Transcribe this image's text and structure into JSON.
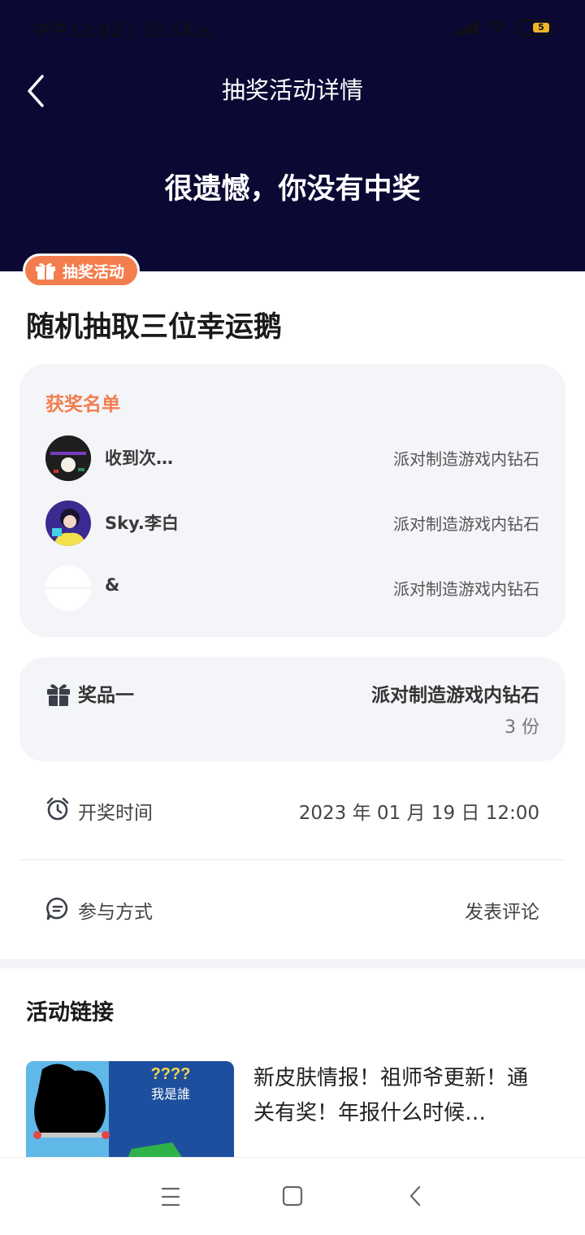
{
  "status_bar": {
    "text": "中午12:02 | 10.5K/s",
    "battery": "5"
  },
  "header": {
    "title": "抽奖活动详情",
    "result": "很遗憾，你没有中奖"
  },
  "activity": {
    "tag": "抽奖活动",
    "title": "随机抽取三位幸运鹅"
  },
  "winners": {
    "title": "获奖名单",
    "list": [
      {
        "name": "收到次…",
        "prize": "派对制造游戏内钻石"
      },
      {
        "name": "Sky.李白",
        "prize": "派对制造游戏内钻石"
      },
      {
        "name": "&",
        "prize": "派对制造游戏内钻石"
      }
    ]
  },
  "prize": {
    "label": "奖品一",
    "name": "派对制造游戏内钻石",
    "count": "3 份"
  },
  "draw_time": {
    "label": "开奖时间",
    "value": "2023 年 01 月 19 日 12:00"
  },
  "participation": {
    "label": "参与方式",
    "value": "发表评论"
  },
  "links": {
    "title": "活动链接",
    "item": {
      "text": "新皮肤情报！祖师爷更新！通关有奖！年报什么时候…",
      "thumb_text_top": "????",
      "thumb_text_mid": "我是誰"
    }
  },
  "colors": {
    "header_bg": "#0b0833",
    "accent": "#f47d4e",
    "panel_bg": "#f3f5f8"
  }
}
